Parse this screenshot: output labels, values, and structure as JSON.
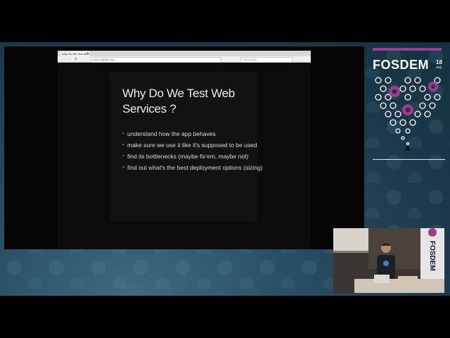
{
  "browser": {
    "tab_title": "Why Do We Test Web Services",
    "tab_close": "×",
    "url": "https://gitlab.org/...",
    "search_placeholder": "Rechercher",
    "nav_back": "←",
    "nav_forward": "→",
    "nav_reload": "↻"
  },
  "slide": {
    "title": "Why Do We Test Web Services ?",
    "bullets": [
      "understand how the app behaves",
      "make sure we use it like it's supposed to be used",
      "find its bottlenecks (maybe fix'em, maybe not)",
      "find out what's the best deployment options (sizing)"
    ]
  },
  "logo": {
    "name": "FOSDEM",
    "year": "18",
    "tld": ".org"
  },
  "camera": {
    "banner_text": "FOSDEM"
  },
  "colors": {
    "background": "#1c3a4d",
    "brand": "#a5398f",
    "slide_bg": "#121212"
  }
}
